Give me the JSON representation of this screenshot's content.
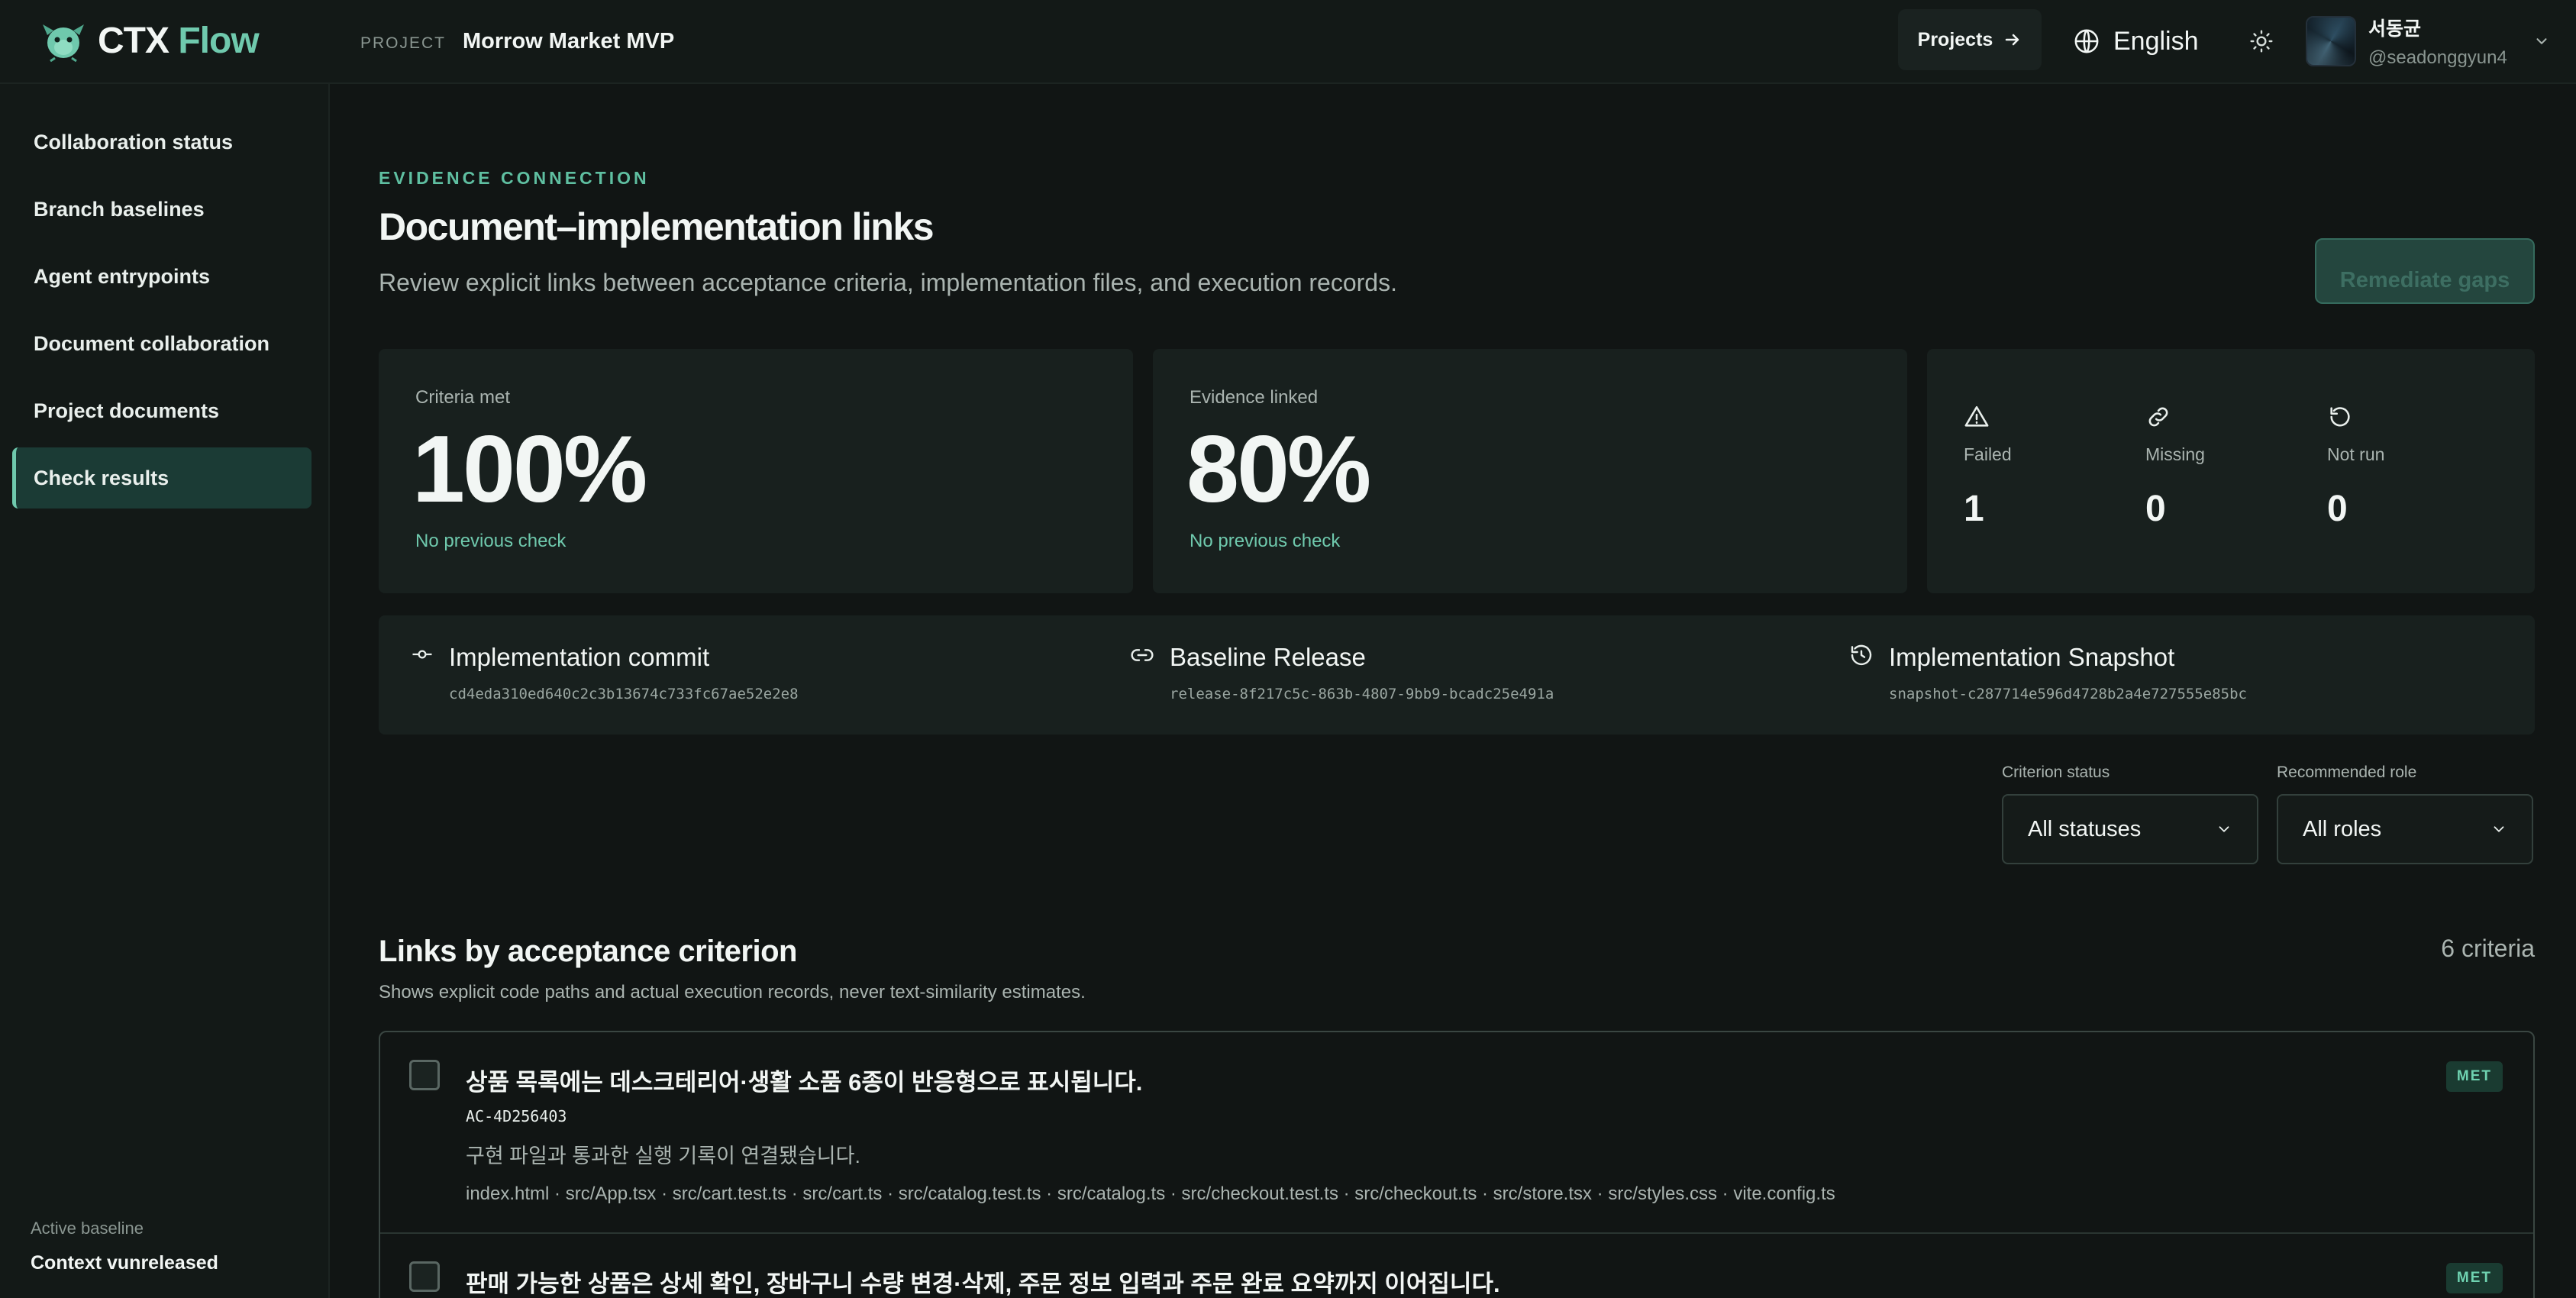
{
  "app": {
    "brand_main": "CTX",
    "brand_accent": "Flow",
    "project_kicker": "PROJECT",
    "project_name": "Morrow Market MVP",
    "projects_button": "Projects",
    "language": "English",
    "user_name": "서동균",
    "user_handle": "@seadonggyun4",
    "accent_color": "#6fc9ad"
  },
  "sidebar": {
    "items": [
      {
        "label": "Collaboration status",
        "active": false
      },
      {
        "label": "Branch baselines",
        "active": false
      },
      {
        "label": "Agent entrypoints",
        "active": false
      },
      {
        "label": "Document collaboration",
        "active": false
      },
      {
        "label": "Project documents",
        "active": false
      },
      {
        "label": "Check results",
        "active": true
      }
    ],
    "baseline_label": "Active baseline",
    "baseline_value": "Context vunreleased"
  },
  "header": {
    "kicker": "EVIDENCE CONNECTION",
    "title": "Document–implementation links",
    "description": "Review explicit links between acceptance criteria, implementation files, and execution records.",
    "remediate_button": "Remediate gaps"
  },
  "metrics": {
    "criteria": {
      "label": "Criteria met",
      "value": "100%",
      "sub": "No previous check"
    },
    "evidence": {
      "label": "Evidence linked",
      "value": "80%",
      "sub": "No previous check"
    },
    "failed": {
      "label": "Failed",
      "value": "1",
      "icon": "warning-triangle-icon"
    },
    "missing": {
      "label": "Missing",
      "value": "0",
      "icon": "link-icon"
    },
    "not_run": {
      "label": "Not run",
      "value": "0",
      "icon": "rotate-icon"
    }
  },
  "refs": {
    "commit": {
      "title": "Implementation commit",
      "hash": "cd4eda310ed640c2c3b13674c733fc67ae52e2e8",
      "icon": "commit-icon"
    },
    "release": {
      "title": "Baseline Release",
      "hash": "release-8f217c5c-863b-4807-9bb9-bcadc25e491a",
      "icon": "link-icon"
    },
    "snapshot": {
      "title": "Implementation Snapshot",
      "hash": "snapshot-c287714e596d4728b2a4e727555e85bc",
      "icon": "history-icon"
    }
  },
  "filters": {
    "status_label": "Criterion status",
    "status_value": "All statuses",
    "role_label": "Recommended role",
    "role_value": "All roles"
  },
  "criteria": {
    "title": "Links by acceptance criterion",
    "count": "6 criteria",
    "description": "Shows explicit code paths and actual execution records, never text-similarity estimates.",
    "rows": [
      {
        "title": "상품 목록에는 데스크테리어·생활 소품 6종이 반응형으로 표시됩니다.",
        "id": "AC-4D256403",
        "desc": "구현 파일과 통과한 실행 기록이 연결됐습니다.",
        "files": "index.html · src/App.tsx · src/cart.test.ts · src/cart.ts · src/catalog.test.ts · src/catalog.ts · src/checkout.test.ts · src/checkout.ts · src/store.tsx · src/styles.css · vite.config.ts",
        "badge": "MET"
      },
      {
        "title": "판매 가능한 상품은 상세 확인, 장바구니 수량 변경·삭제, 주문 정보 입력과 주문 완료 요약까지 이어집니다.",
        "badge": "MET"
      }
    ]
  }
}
